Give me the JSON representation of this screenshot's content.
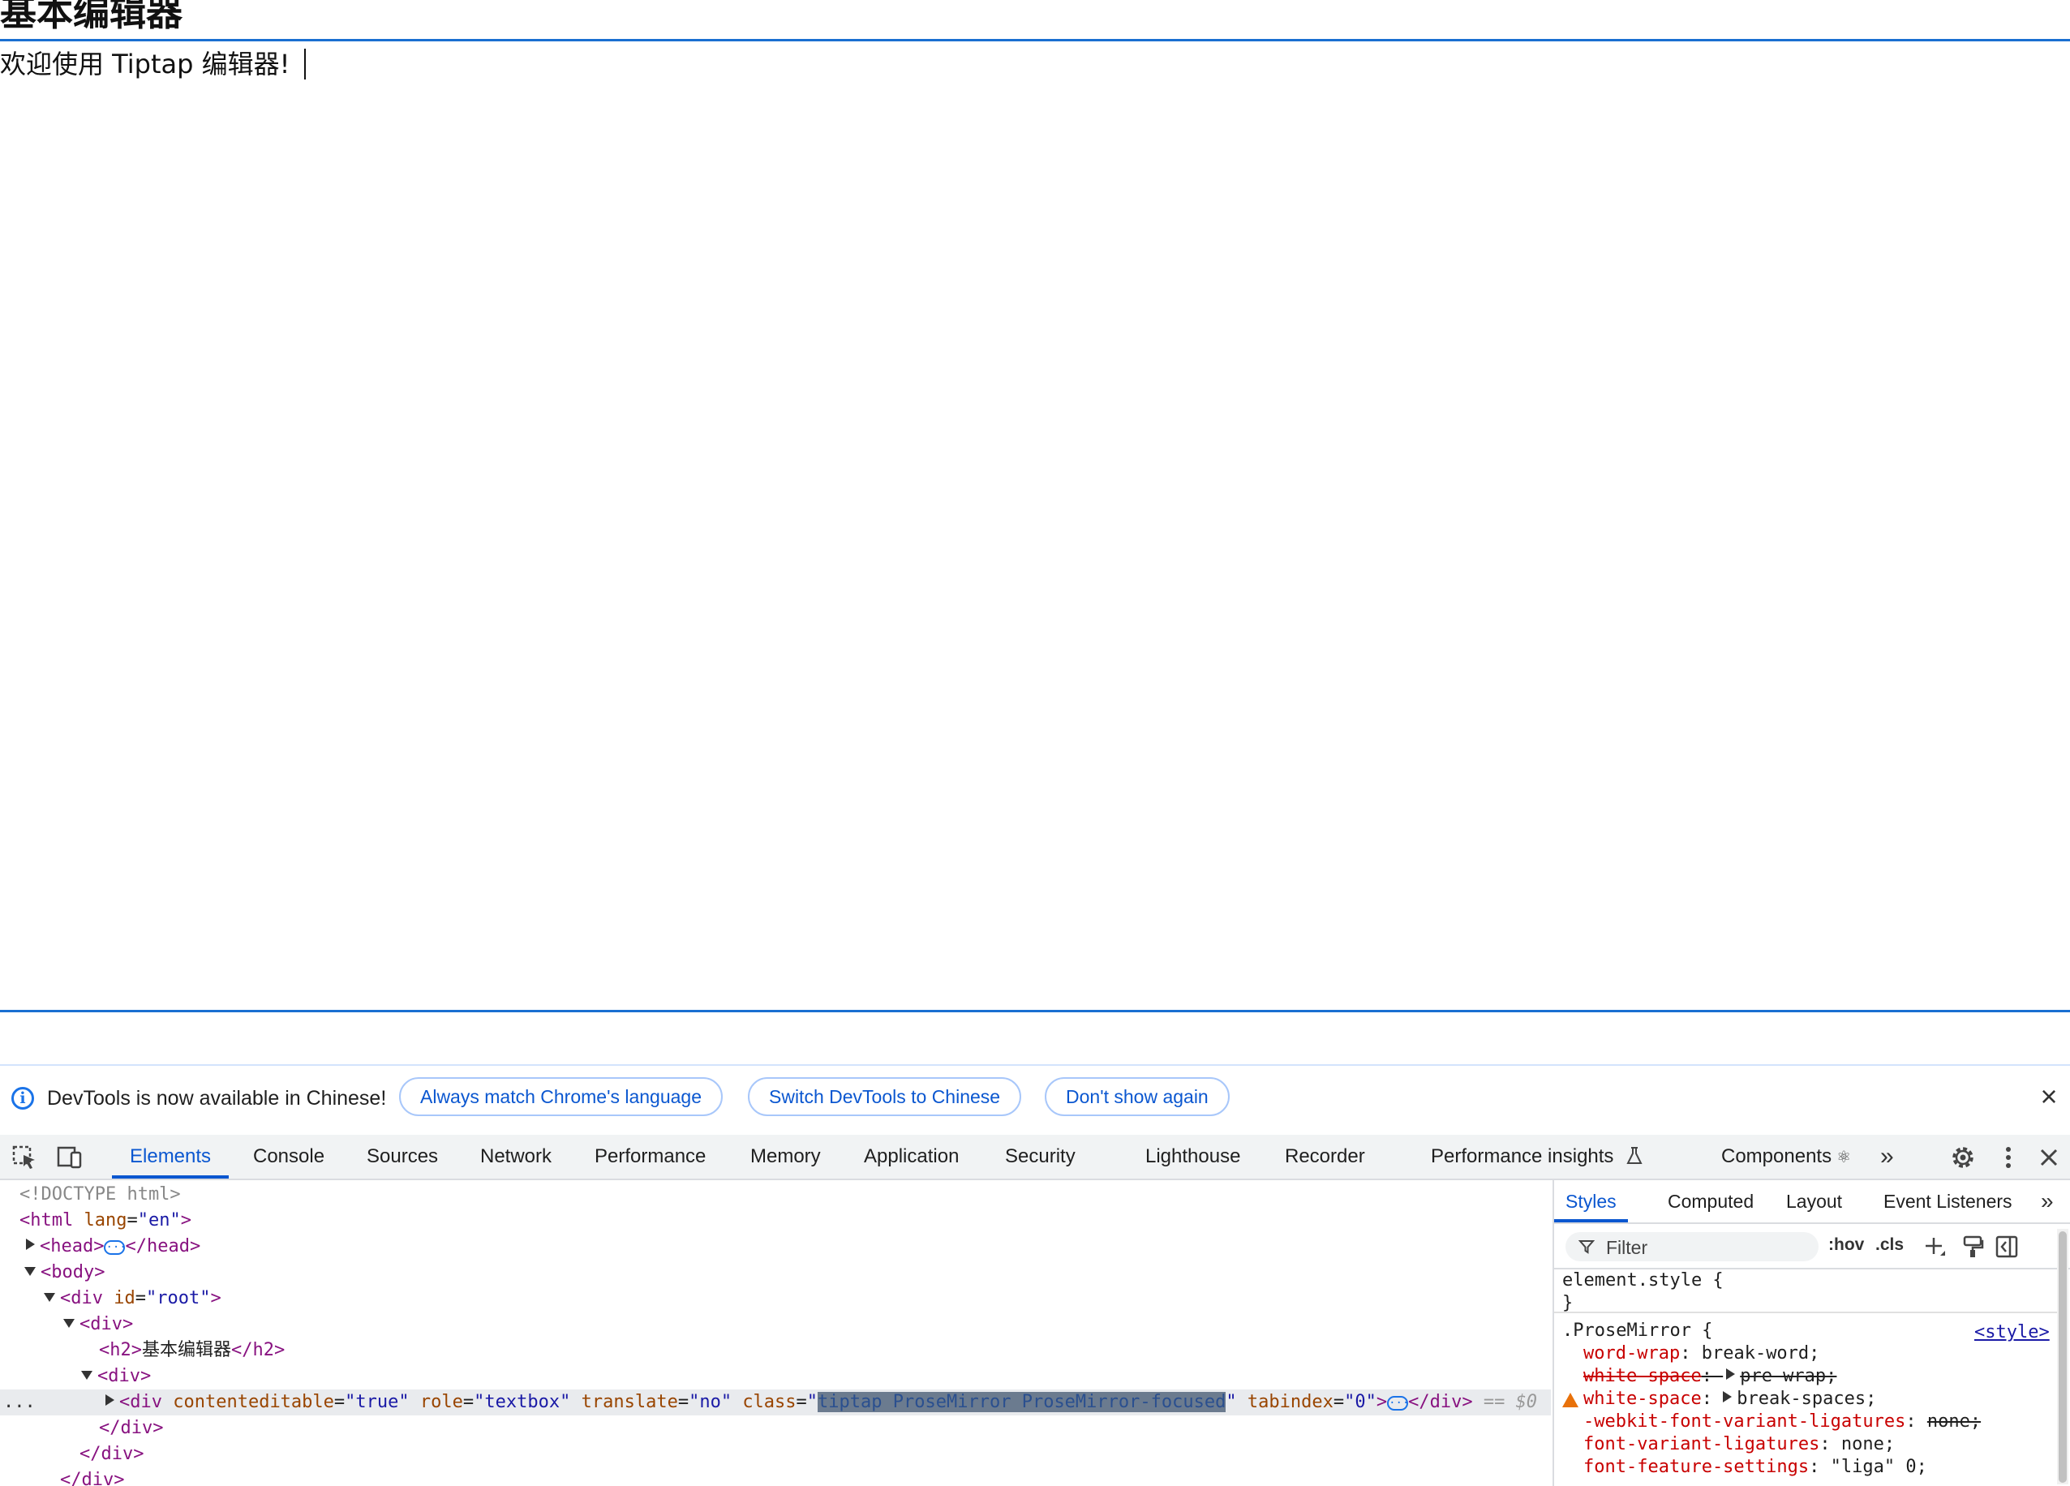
{
  "page": {
    "heading": "基本编辑器",
    "editor_text": "欢迎使用 Tiptap 编辑器!"
  },
  "devtools": {
    "infobar": {
      "message": "DevTools is now available in Chinese!",
      "buttons": [
        "Always match Chrome's language",
        "Switch DevTools to Chinese",
        "Don't show again"
      ]
    },
    "tabs": [
      {
        "label": "Elements",
        "active": true
      },
      {
        "label": "Console"
      },
      {
        "label": "Sources"
      },
      {
        "label": "Network"
      },
      {
        "label": "Performance"
      },
      {
        "label": "Memory"
      },
      {
        "label": "Application"
      },
      {
        "label": "Security"
      },
      {
        "label": "Lighthouse"
      },
      {
        "label": "Recorder"
      },
      {
        "label": "Performance insights"
      },
      {
        "label": "Components"
      }
    ],
    "tab_suffix_components": "⚛",
    "dom": {
      "doctype": "<!DOCTYPE html>",
      "html_open": "<html",
      "lang_attr": "lang",
      "lang_val": "\"en\"",
      "head_open": "<head>",
      "head_close": "</head>",
      "body_open": "<body>",
      "div_open": "<div",
      "id_attr": "id",
      "id_val": "\"root\"",
      "div_plain": "<div>",
      "h2_open": "<h2>",
      "h2_text": "基本编辑器",
      "h2_close": "</h2>",
      "ce_attr": "contenteditable",
      "ce_val": "\"true\"",
      "role_attr": "role",
      "role_val": "\"textbox\"",
      "translate_attr": "translate",
      "translate_val": "\"no\"",
      "class_attr": "class",
      "class_val": "tiptap ProseMirror ProseMirror-focused",
      "tabindex_attr": "tabindex",
      "tabindex_val": "\"0\"",
      "div_close": "</div>",
      "eq0": "== $0",
      "gutter": "..."
    },
    "styles": {
      "tabs": [
        "Styles",
        "Computed",
        "Layout",
        "Event Listeners"
      ],
      "filter_placeholder": "Filter",
      "hov": ":hov",
      "cls": ".cls",
      "element_style_open": "element.style {",
      "close_brace": "}",
      "rule_selector": ".ProseMirror {",
      "rule_source": "<style>",
      "props": [
        {
          "name": "word-wrap",
          "value": "break-word;"
        },
        {
          "name": "white-space",
          "value": "pre-wrap;",
          "struck": true
        },
        {
          "name": "white-space",
          "value": "break-spaces;"
        },
        {
          "name": "-webkit-font-variant-ligatures",
          "value": "none;",
          "warning": true
        },
        {
          "name": "font-variant-ligatures",
          "value": "none;"
        },
        {
          "name": "font-feature-settings",
          "value": "\"liga\" 0;"
        }
      ]
    },
    "colors": {
      "accent": "#0b57d0",
      "editor_border": "#1a6fd1",
      "warning": "#e8710a"
    }
  }
}
